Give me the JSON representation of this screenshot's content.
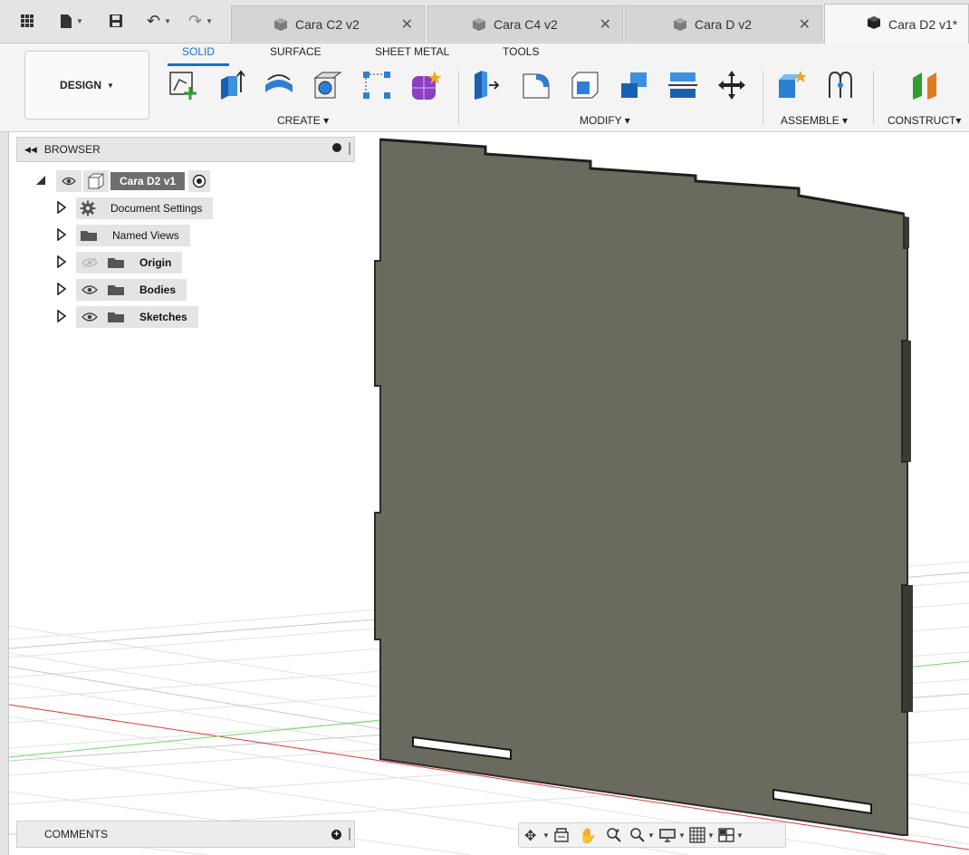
{
  "tabs": [
    {
      "label": "Cara C2 v2",
      "active": false
    },
    {
      "label": "Cara C4 v2",
      "active": false
    },
    {
      "label": "Cara D v2",
      "active": false
    },
    {
      "label": "Cara D2 v1*",
      "active": true
    }
  ],
  "tab_close_glyph": "✕",
  "ribbon": {
    "workspace": "DESIGN",
    "tabs": [
      "SOLID",
      "SURFACE",
      "SHEET METAL",
      "TOOLS"
    ],
    "active_tab": "SOLID",
    "groups": {
      "create": "CREATE",
      "modify": "MODIFY",
      "assemble": "ASSEMBLE",
      "construct": "CONSTRUCT"
    },
    "accent_color": "#1a6fc8"
  },
  "browser": {
    "title": "BROWSER",
    "root": "Cara D2 v1",
    "items": [
      {
        "label": "Document Settings",
        "icon": "gear-icon"
      },
      {
        "label": "Named Views",
        "icon": "folder-icon"
      },
      {
        "label": "Origin",
        "icon": "folder-icon",
        "visible": false
      },
      {
        "label": "Bodies",
        "icon": "folder-icon",
        "visible": true
      },
      {
        "label": "Sketches",
        "icon": "folder-icon",
        "visible": true
      }
    ]
  },
  "comments": {
    "title": "COMMENTS"
  },
  "model": {
    "color": "#6b6a5f",
    "edge_color": "#2a2a2a"
  }
}
